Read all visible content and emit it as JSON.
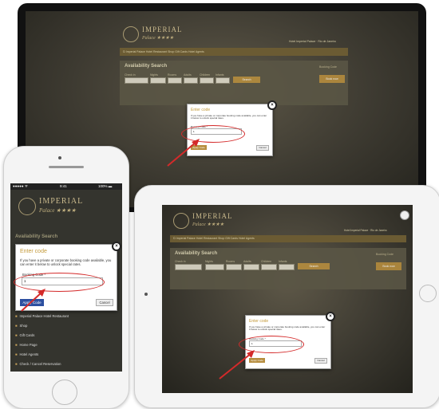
{
  "site": {
    "logo_line1": "IMPERIAL",
    "logo_line2": "Palace ★★★★"
  },
  "desktop": {
    "top_links": "Ὠ Imperial Palace Hotel Restaurant   Shop   Gift Cards   Hotel Agents",
    "header_right": "Hotel Imperial Palace · Rio de Janeiro",
    "search_title": "Availability Search",
    "field_labels": [
      "Check in",
      "Nights",
      "Rooms",
      "Adults",
      "Children",
      "Infants"
    ],
    "search_button": "Search",
    "side_link": "Booking Code",
    "side_button": "Book now"
  },
  "modal": {
    "title": "Enter code",
    "text": "If you have a private or corporate booking code available, you can enter it below to unlock special rates.",
    "label": "Booking Code *",
    "value": "1",
    "apply": "Apply Code",
    "cancel": "Cancel",
    "close": "×"
  },
  "phone": {
    "status_left": "●●●●● ᯤ",
    "status_time": "9:41",
    "status_right": "100% ▬",
    "search_title": "Availability Search",
    "menu": [
      "Imperial Palace Hotel Restaurant",
      "Shop",
      "Gift Cards",
      "Home Page",
      "Hotel Agents",
      "Check / Cancel Reservation"
    ]
  },
  "colors": {
    "accent": "#c49a3a",
    "highlight": "#d42a2a",
    "page_bg": "#3d3a31"
  }
}
